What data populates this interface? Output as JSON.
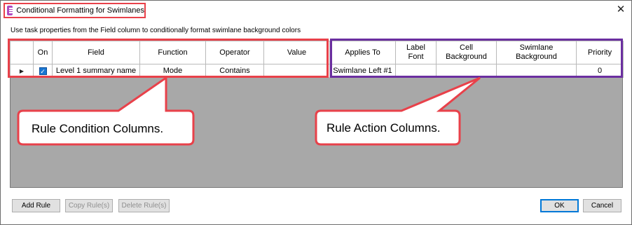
{
  "window": {
    "title": "Conditional Formatting for Swimlanes"
  },
  "instruction": "Use task properties from the Field column to conditionally format swimlane background colors",
  "table": {
    "headers": {
      "on": "On",
      "field": "Field",
      "function": "Function",
      "operator": "Operator",
      "value": "Value",
      "applies_to": "Applies To",
      "label_font": "Label Font",
      "cell_background": "Cell Background",
      "swimlane_background": "Swimlane Background",
      "priority": "Priority"
    },
    "rows": [
      {
        "on": true,
        "field": "Level 1 summary name",
        "function": "Mode",
        "operator": "Contains",
        "value": "",
        "applies_to": "Swimlane Left #1",
        "label_font": "",
        "cell_background": "",
        "swimlane_background": "",
        "priority": "0"
      }
    ]
  },
  "callouts": {
    "condition": "Rule Condition Columns.",
    "action": "Rule Action Columns."
  },
  "buttons": {
    "add_rule": "Add Rule",
    "copy_rules": "Copy Rule(s)",
    "delete_rules": "Delete Rule(s)",
    "ok": "OK",
    "cancel": "Cancel"
  },
  "colors": {
    "condition_highlight": "#e8414a",
    "action_highlight": "#6b2fa0",
    "grid_background": "#a8a8a8",
    "checkbox": "#1976d2"
  }
}
